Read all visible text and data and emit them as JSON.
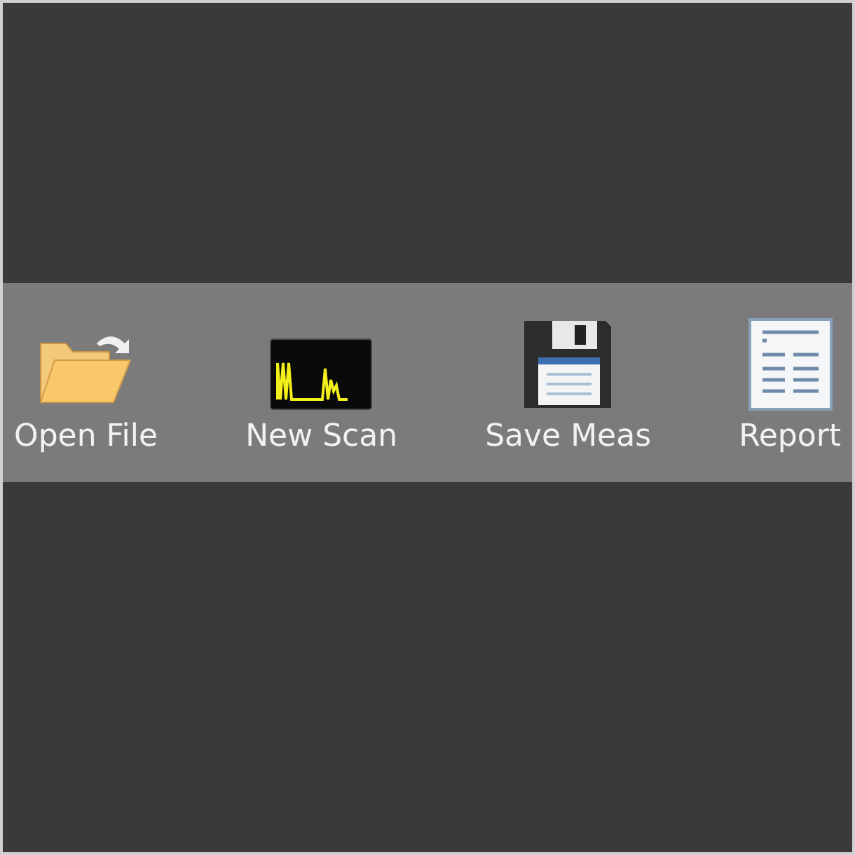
{
  "toolbar": {
    "buttons": [
      {
        "kind": "open",
        "label": "Open File"
      },
      {
        "kind": "scan",
        "label": "New Scan"
      },
      {
        "kind": "save",
        "label": "Save Meas"
      },
      {
        "kind": "report",
        "label": "Report"
      }
    ]
  }
}
